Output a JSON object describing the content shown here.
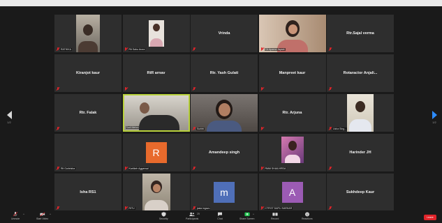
{
  "meeting": {
    "tiles": [
      {
        "id": "r1c1",
        "kind": "video",
        "label": "RATHIKA",
        "muted": true
      },
      {
        "id": "r1c2",
        "kind": "video",
        "label": "Rit Sahu Arora",
        "muted": true
      },
      {
        "id": "r1c3",
        "kind": "name",
        "name": "Vrinda",
        "muted": true
      },
      {
        "id": "r1c4",
        "kind": "video",
        "label": "CA Aparna Jayant",
        "muted": true
      },
      {
        "id": "r1c5",
        "kind": "name",
        "name": "Rtr.Sajal verma",
        "muted": true
      },
      {
        "id": "r2c1",
        "kind": "name",
        "name": "Kiranjot kaur",
        "muted": true
      },
      {
        "id": "r2c2",
        "kind": "name",
        "name": "RtR arnav",
        "muted": true
      },
      {
        "id": "r2c3",
        "kind": "name",
        "name": "Rtr. Yash Gulati",
        "muted": true
      },
      {
        "id": "r2c4",
        "kind": "name",
        "name": "Manpreet kaur",
        "muted": true
      },
      {
        "id": "r2c5",
        "kind": "name",
        "name": "Rotaractor Anjali...",
        "muted": true
      },
      {
        "id": "r3c1",
        "kind": "name",
        "name": "Rtr. Falak",
        "muted": true
      },
      {
        "id": "r3c2",
        "kind": "video",
        "label": "Sudi Mehra",
        "muted": false,
        "active": true
      },
      {
        "id": "r3c3",
        "kind": "video",
        "label": "Surbhi",
        "muted": true
      },
      {
        "id": "r3c4",
        "kind": "name",
        "name": "Rtr. Arjuna",
        "muted": true
      },
      {
        "id": "r3c5",
        "kind": "video",
        "label": "Usha Sing...",
        "muted": true
      },
      {
        "id": "r4c1",
        "kind": "name",
        "name": "",
        "label": "Rit Gurleisha",
        "muted": true
      },
      {
        "id": "r4c2",
        "kind": "avatar",
        "letter": "R",
        "avatar_color": "#e86a2c",
        "label": "Kartikeh Aggarwal",
        "muted": true
      },
      {
        "id": "r4c3",
        "kind": "name",
        "name": "Amandeep singh",
        "muted": true
      },
      {
        "id": "r4c4",
        "kind": "video",
        "label": "RMM SHAILVIRDA",
        "muted": true
      },
      {
        "id": "r4c5",
        "kind": "name",
        "name": "Harinder JH",
        "muted": true
      },
      {
        "id": "r5c1",
        "kind": "name",
        "name": "Isha RS1",
        "muted": true
      },
      {
        "id": "r5c2",
        "kind": "video",
        "label": "RITU",
        "muted": true
      },
      {
        "id": "r5c3",
        "kind": "avatar",
        "letter": "m",
        "avatar_color": "#4f6fb8",
        "label": "jasia ingavo",
        "muted": true
      },
      {
        "id": "r5c4",
        "kind": "avatar",
        "letter": "A",
        "avatar_color": "#9b5bb4",
        "label": "CTFIST DAPLI SARKAR",
        "muted": true
      },
      {
        "id": "r5c5",
        "kind": "name",
        "name": "Sukhdeep Kaur",
        "muted": true
      }
    ],
    "pager": {
      "left_page": "1/2",
      "right_page": "1/2"
    }
  },
  "toolbar": {
    "items": [
      {
        "name": "unmute",
        "label": "Unmute",
        "icon": "mic-muted-icon"
      },
      {
        "name": "start-video",
        "label": "Start Video",
        "icon": "camera-off-icon"
      },
      {
        "name": "security",
        "label": "Security",
        "icon": "shield-icon"
      },
      {
        "name": "participants",
        "label": "Participants",
        "icon": "participants-icon",
        "count": "25"
      },
      {
        "name": "chat",
        "label": "Chat",
        "icon": "chat-icon"
      },
      {
        "name": "share-screen",
        "label": "Share Screen",
        "icon": "share-screen-icon"
      },
      {
        "name": "record",
        "label": "Record",
        "icon": "record-icon"
      },
      {
        "name": "reactions",
        "label": "Reactions",
        "icon": "reactions-icon"
      }
    ],
    "end_label": "Leave"
  },
  "colors": {
    "active_border": "#b9d23c",
    "share_green": "#23c552",
    "end_red": "#e0242a",
    "arrow_blue": "#2d8cff"
  }
}
